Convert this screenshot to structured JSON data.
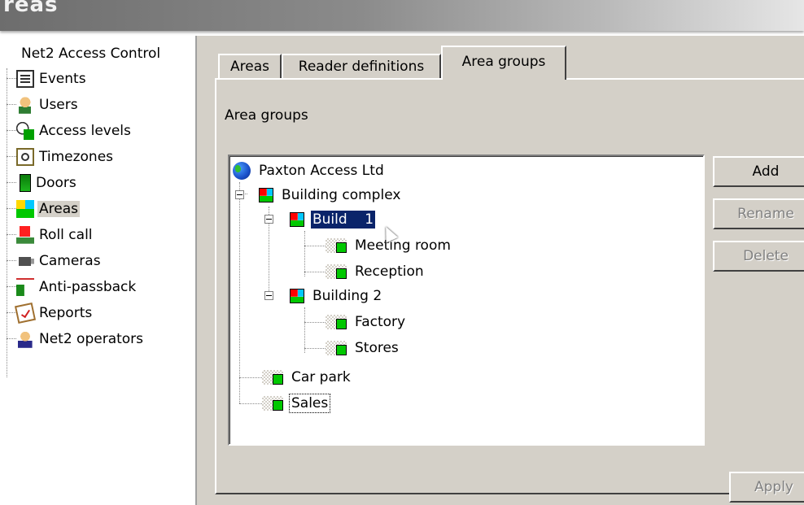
{
  "window": {
    "title": "reas"
  },
  "nav": {
    "root_label": "Net2 Access Control",
    "items": [
      {
        "label": "Events",
        "icon": "events-icon"
      },
      {
        "label": "Users",
        "icon": "users-icon"
      },
      {
        "label": "Access levels",
        "icon": "access-levels-icon"
      },
      {
        "label": "Timezones",
        "icon": "timezones-icon"
      },
      {
        "label": "Doors",
        "icon": "door-icon"
      },
      {
        "label": "Areas",
        "icon": "areas-icon",
        "selected": true
      },
      {
        "label": "Roll call",
        "icon": "roll-call-icon"
      },
      {
        "label": "Cameras",
        "icon": "camera-icon"
      },
      {
        "label": "Anti-passback",
        "icon": "anti-passback-icon"
      },
      {
        "label": "Reports",
        "icon": "reports-icon"
      },
      {
        "label": "Net2 operators",
        "icon": "operators-icon"
      }
    ]
  },
  "tabs": [
    {
      "label": "Areas"
    },
    {
      "label": "Reader definitions"
    },
    {
      "label": "Area groups",
      "active": true
    }
  ],
  "content": {
    "section_label": "Area groups",
    "tree": [
      {
        "label": "Paxton Access Ltd",
        "icon": "globe-icon"
      },
      {
        "label": "Building complex",
        "icon": "area-group-icon"
      },
      {
        "label": "Build    1",
        "icon": "area-group-icon",
        "selected": true
      },
      {
        "label": "Meeting room",
        "icon": "area-icon"
      },
      {
        "label": "Reception",
        "icon": "area-icon"
      },
      {
        "label": "Building 2",
        "icon": "area-group-icon"
      },
      {
        "label": "Factory",
        "icon": "area-icon"
      },
      {
        "label": "Stores",
        "icon": "area-icon"
      },
      {
        "label": "Car park",
        "icon": "area-icon"
      },
      {
        "label": "Sales",
        "icon": "area-icon",
        "focused": true
      }
    ]
  },
  "buttons": {
    "add": "Add",
    "rename": "Rename",
    "delete": "Delete",
    "apply": "Apply"
  }
}
